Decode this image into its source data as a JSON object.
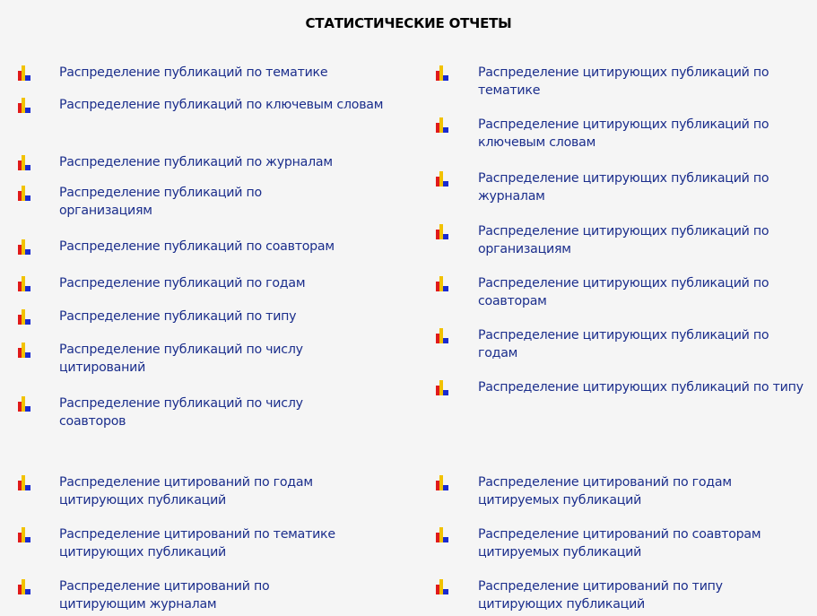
{
  "page": {
    "title": "СТАТИСТИЧЕСКИЕ ОТЧЕТЫ"
  },
  "icon": "bar-chart-icon",
  "colors": {
    "link": "#1b2e8c",
    "bar_red": "#e01a1a",
    "bar_yellow": "#f2c200",
    "bar_blue": "#1a2bd0",
    "background": "#f5f5f5"
  },
  "left": {
    "items": [
      "Распределение публикаций по тематике",
      "Распределение публикаций по ключевым словам",
      "Распределение публикаций по журналам",
      "Распределение публикаций по организациям",
      "Распределение публикаций по соавторам",
      "Распределение публикаций по годам",
      "Распределение публикаций по типу",
      "Распределение публикаций по числу цитирований",
      "Распределение публикаций по числу соавторов",
      "Распределение цитирований по годам цитирующих публикаций",
      "Распределение цитирований по тематике цитирующих публикаций",
      "Распределение цитирований по цитирующим журналам"
    ]
  },
  "right": {
    "items": [
      "Распределение цитирующих публикаций по тематике",
      "Распределение цитирующих публикаций по ключевым словам",
      "Распределение цитирующих публикаций по журналам",
      "Распределение цитирующих публикаций по организациям",
      "Распределение цитирующих публикаций по соавторам",
      "Распределение цитирующих публикаций по годам",
      "Распределение цитирующих публикаций по типу",
      "Распределение цитирований по годам цитируемых публикаций",
      "Распределение цитирований по соавторам цитируемых публикаций",
      "Распределение цитирований по типу цитирующих публикаций"
    ]
  }
}
